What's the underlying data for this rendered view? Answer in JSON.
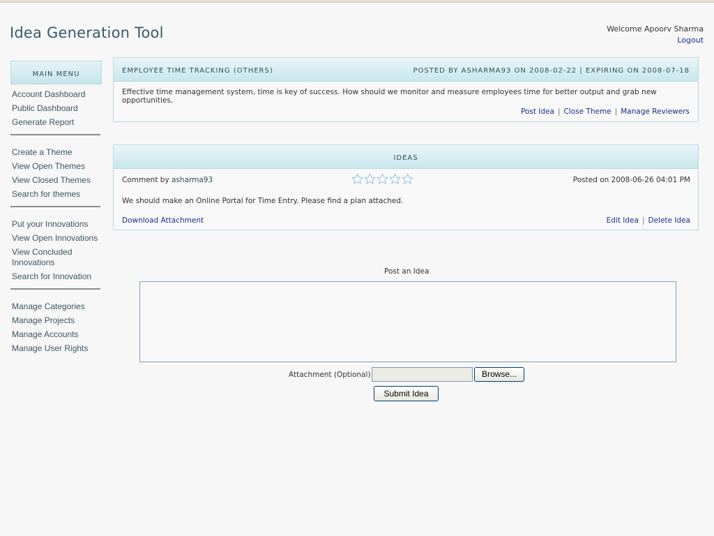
{
  "app": {
    "title": "Idea Generation Tool"
  },
  "user": {
    "welcome": "Welcome Apoorv Sharma",
    "logout": "Logout"
  },
  "sidebar": {
    "header": "MAIN MENU",
    "groups": [
      {
        "items": [
          "Account Dashboard",
          "Public Dashboard",
          "Generate Report"
        ]
      },
      {
        "items": [
          "Create a Theme",
          "View Open Themes",
          "View Closed Themes",
          "Search for themes"
        ]
      },
      {
        "items": [
          "Put your Innovations",
          "View Open Innovations",
          "View Concluded Innovations",
          "Search for Innovation"
        ]
      },
      {
        "items": [
          "Manage Categories",
          "Manage Projects",
          "Manage Accounts",
          "Manage User Rights"
        ]
      }
    ]
  },
  "theme": {
    "title": "EMPLOYEE TIME TRACKING (OTHERS)",
    "meta": "POSTED BY ASHARMA93 ON 2008-02-22 | EXPIRING ON 2008-07-18",
    "description": "Effective time management system, time is key of success. How should we monitor and measure employees time for better output and grab new opportunities.",
    "actions": [
      "Post Idea",
      "Close Theme",
      "Manage Reviewers"
    ]
  },
  "ideas": {
    "header": "IDEAS",
    "comment_prefix": "Comment by",
    "author": "asharma93",
    "rating_stars": 5,
    "rating_value": 0,
    "posted_on": "Posted on 2008-06-26 04:01 PM",
    "text": "We should make an Online Portal for Time Entry. Please find a plan attached.",
    "download": "Download Attachment",
    "actions": [
      "Edit Idea",
      "Delete Idea"
    ]
  },
  "post_form": {
    "label": "Post an Idea",
    "textarea_value": "",
    "attachment_label": "Attachment (Optional):",
    "attachment_value": "",
    "browse_label": "Browse...",
    "submit_label": "Submit Idea"
  }
}
